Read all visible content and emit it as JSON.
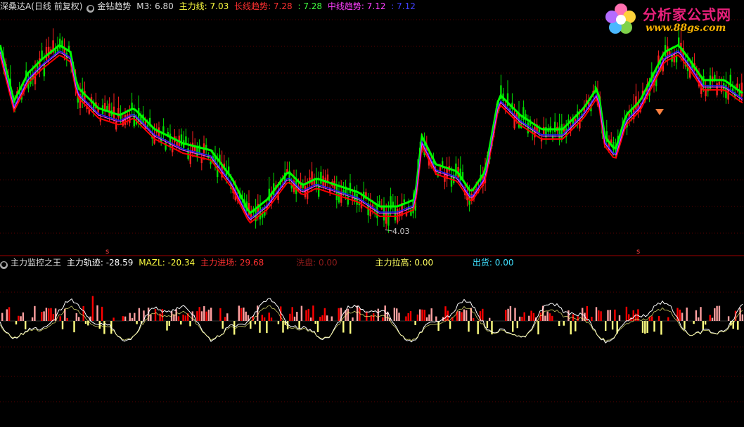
{
  "top_panel": {
    "title": "深桑达A(日线 前复权)",
    "indicator_name": "金钻趋势",
    "m3": "M3: 6.80",
    "main_line": "主力线: 7.03",
    "long_trend_label": "长线趋势",
    "long_trend_value": ": 7.28",
    "long_trend_value2": ": 7.28",
    "mid_trend_label": "中线趋势",
    "mid_trend_value": ": 7.12",
    "mid_trend_value2": ": 7.12",
    "low_price_annotation": "4.03"
  },
  "bottom_panel": {
    "indicator_name": "主力监控之王",
    "track": "主力轨迹: -28.59",
    "mazl": "MAZL: -20.34",
    "entry": "主力进场: 29.68",
    "wash": "洗盘: 0.00",
    "pull": "主力拉高: 0.00",
    "sell": "出货: 0.00"
  },
  "logo": {
    "brand": "分析家公式网",
    "url": "www.88gs.com"
  },
  "colors": {
    "up": "#ff2020",
    "down": "#00e000",
    "ma_green": "#00ff00",
    "ma_red": "#ff0000",
    "ma_blue": "#2020ff",
    "ma_magenta": "#ff40ff",
    "bar_pink": "#ffa0a0",
    "bar_yellow": "#ffff80"
  }
}
